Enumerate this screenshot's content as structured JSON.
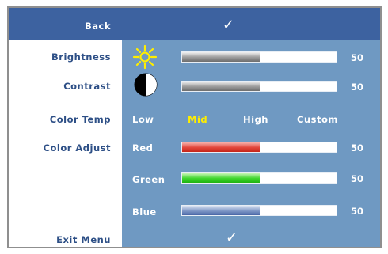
{
  "menu": {
    "back_label": "Back",
    "exit_label": "Exit Menu",
    "confirm_icon": "check-icon",
    "accent_color": "#3d62a0",
    "panel_color": "#6f99c2"
  },
  "brightness": {
    "label": "Brightness",
    "value": "50",
    "level": 0.5,
    "icon": "sun-icon"
  },
  "contrast": {
    "label": "Contrast",
    "value": "50",
    "level": 0.5,
    "icon": "contrast-icon"
  },
  "color_temp": {
    "label": "Color Temp",
    "options": [
      "Low",
      "Mid",
      "High",
      "Custom"
    ],
    "selected": "Mid"
  },
  "color_adjust": {
    "label": "Color Adjust",
    "red": {
      "label": "Red",
      "value": "50",
      "level": 0.5
    },
    "green": {
      "label": "Green",
      "value": "50",
      "level": 0.5
    },
    "blue": {
      "label": "Blue",
      "value": "50",
      "level": 0.5
    }
  }
}
